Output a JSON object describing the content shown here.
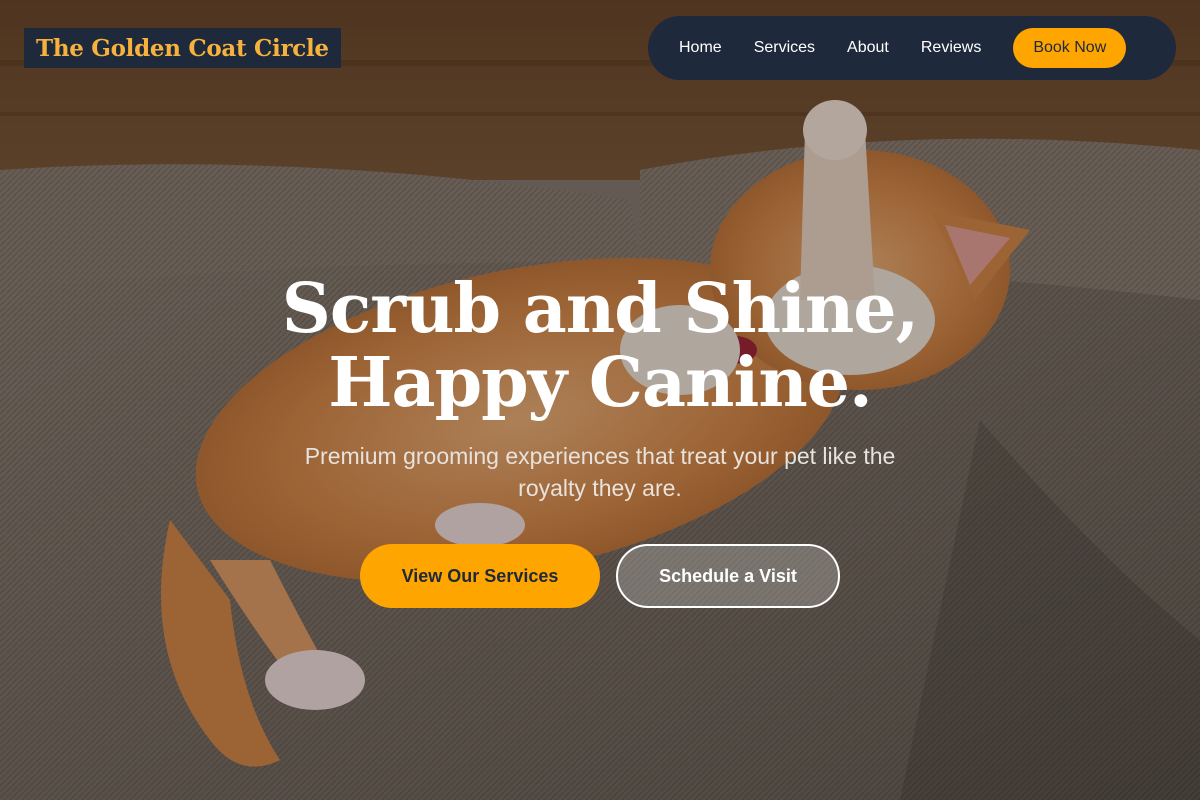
{
  "brand": {
    "name": "The Golden Coat Circle"
  },
  "nav": {
    "items": [
      {
        "label": "Home"
      },
      {
        "label": "Services"
      },
      {
        "label": "About"
      },
      {
        "label": "Reviews"
      }
    ],
    "cta_label": "Book Now"
  },
  "hero": {
    "headline_line1": "Scrub and Shine,",
    "headline_line2": "Happy Canine.",
    "subtitle": "Premium grooming experiences that treat your pet like the royalty they are.",
    "primary_button": "View Our Services",
    "secondary_button": "Schedule a Visit",
    "background_image": "orange-tabby-cat-on-couch"
  },
  "colors": {
    "accent": "#ffa500",
    "brand_text": "#f6b23c",
    "dark": "#1e293b"
  }
}
